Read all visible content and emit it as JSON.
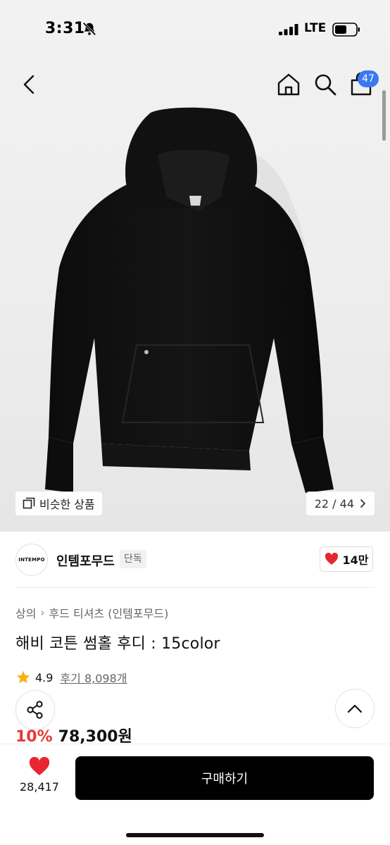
{
  "status_bar": {
    "time": "3:31",
    "network": "LTE"
  },
  "header": {
    "cart_count": "47"
  },
  "gallery": {
    "similar_label": "비슷한 상품",
    "counter": "22 / 44"
  },
  "brand": {
    "logo_text": "INTEMPO",
    "name": "인템포무드",
    "tag": "단독",
    "likes": "14만"
  },
  "product": {
    "breadcrumb": [
      "상의",
      "후드 티셔츠 (인템포무드)"
    ],
    "title": "해비 코튼 썸홀 후디 : 15color",
    "rating": "4.9",
    "reviews": "후기 8,098개",
    "original_price_suffix": "원",
    "discount": "10%",
    "price": "78,300원"
  },
  "bottom_bar": {
    "wish_count": "28,417",
    "buy_label": "구매하기"
  },
  "colors": {
    "accent": "#3a78f2",
    "discount": "#e53935",
    "heart": "#e8262f",
    "star": "#f5b014",
    "buy_button": "#000000"
  }
}
